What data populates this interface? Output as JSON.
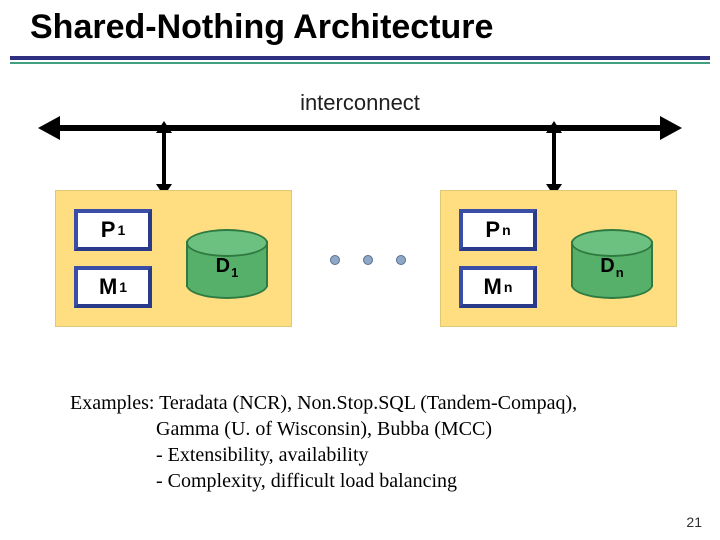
{
  "title": "Shared-Nothing Architecture",
  "interconnect_label": "interconnect",
  "left_node": {
    "processor": {
      "letter": "P",
      "sub": "1"
    },
    "memory": {
      "letter": "M",
      "sub": "1"
    },
    "disk": {
      "letter": "D",
      "sub": "1"
    }
  },
  "right_node": {
    "processor": {
      "letter": "P",
      "sub": "n"
    },
    "memory": {
      "letter": "M",
      "sub": "n"
    },
    "disk": {
      "letter": "D",
      "sub": "n"
    }
  },
  "ellipsis_dots": 3,
  "examples": {
    "lead": "Examples:",
    "line1_rest": " Teradata (NCR), Non.Stop.SQL (Tandem-Compaq),",
    "line2": "Gamma (U. of Wisconsin), Bubba (MCC)",
    "line3": "- Extensibility, availability",
    "line4": "- Complexity, difficult load balancing"
  },
  "page_number": "21",
  "colors": {
    "title_rule_primary": "#2f2f7f",
    "title_rule_secondary": "#40a080",
    "node_bg": "#ffde82",
    "box_border": "#3a4ea8",
    "disk_fill": "#56b06a"
  }
}
